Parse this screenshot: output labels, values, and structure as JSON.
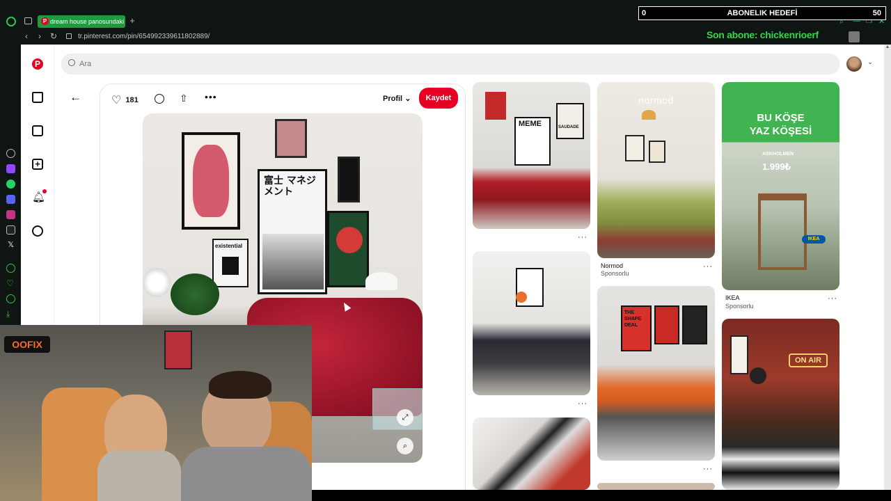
{
  "browser": {
    "tab_title": "dream house panosundaki",
    "url": "tr.pinterest.com/pin/654992339611802889/"
  },
  "overlay": {
    "goal_left": "0",
    "goal_label": "ABONELIK HEDEFİ",
    "goal_right": "50",
    "last_sub": "Son abone: chickenrioerf"
  },
  "pinterest": {
    "search_placeholder": "Ara",
    "like_count": "181",
    "profile_label": "Profil",
    "save_label": "Kaydet"
  },
  "grid": {
    "normod_title": "Normod",
    "normod_sub": "Sponsorlu",
    "ikea_title": "IKEA",
    "ikea_sub": "Sponsorlu",
    "ikea_ad_line1": "BU KÖŞE",
    "ikea_ad_line2": "YAZ KÖŞESİ",
    "ikea_product": "ASKHOLMEN",
    "ikea_price": "1.999₺",
    "ikea_logo": "IKEA",
    "normod_logo": "normod",
    "meme_text": "MEME",
    "saudade_text": "SAUDADE",
    "onair_text": "ON AIR",
    "shape_text": "THE SHAPE DEAL"
  },
  "main_pin": {
    "poster_jp": "富士 マネジメント",
    "poster_existential": "existential"
  },
  "stream": {
    "logo": "OOFIX"
  },
  "colors": {
    "pinterest_red": "#e60023",
    "opera_green": "#1f9a3e",
    "overlay_green": "#39d34a"
  }
}
